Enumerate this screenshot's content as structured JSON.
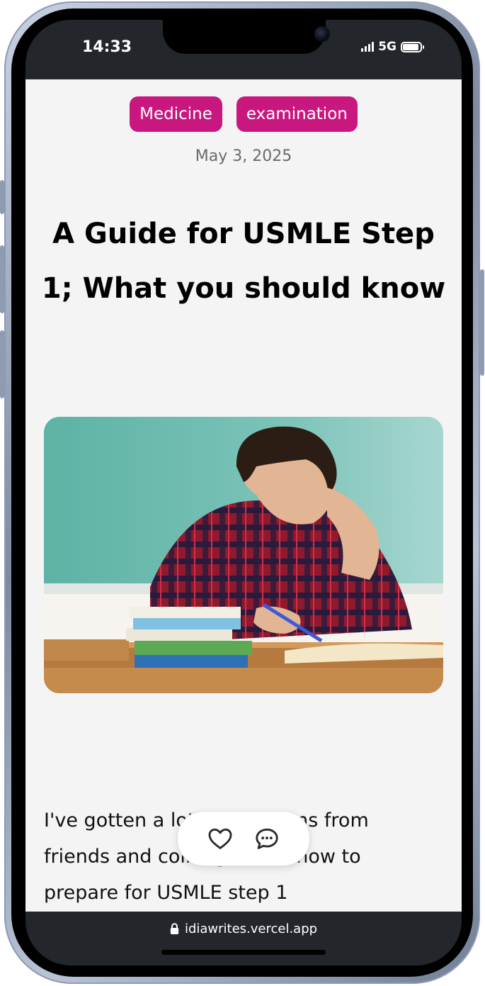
{
  "status_bar": {
    "time": "14:33",
    "network": "5G"
  },
  "article": {
    "tags": [
      "Medicine",
      "examination"
    ],
    "date": "May 3, 2025",
    "title": "A Guide for USMLE Step 1; What you should know",
    "body_lines": [
      "I've gotten a lot of questions from",
      "friends and colleagues on how to",
      "prepare for USMLE step 1"
    ]
  },
  "reactions": {
    "like_icon": "heart-icon",
    "comment_icon": "comment-icon"
  },
  "browser": {
    "url": "idiawrites.vercel.app",
    "lock_icon": "lock-icon"
  },
  "colors": {
    "accent": "#c8187f",
    "chrome": "#23272b",
    "page_bg": "#f4f4f4"
  }
}
